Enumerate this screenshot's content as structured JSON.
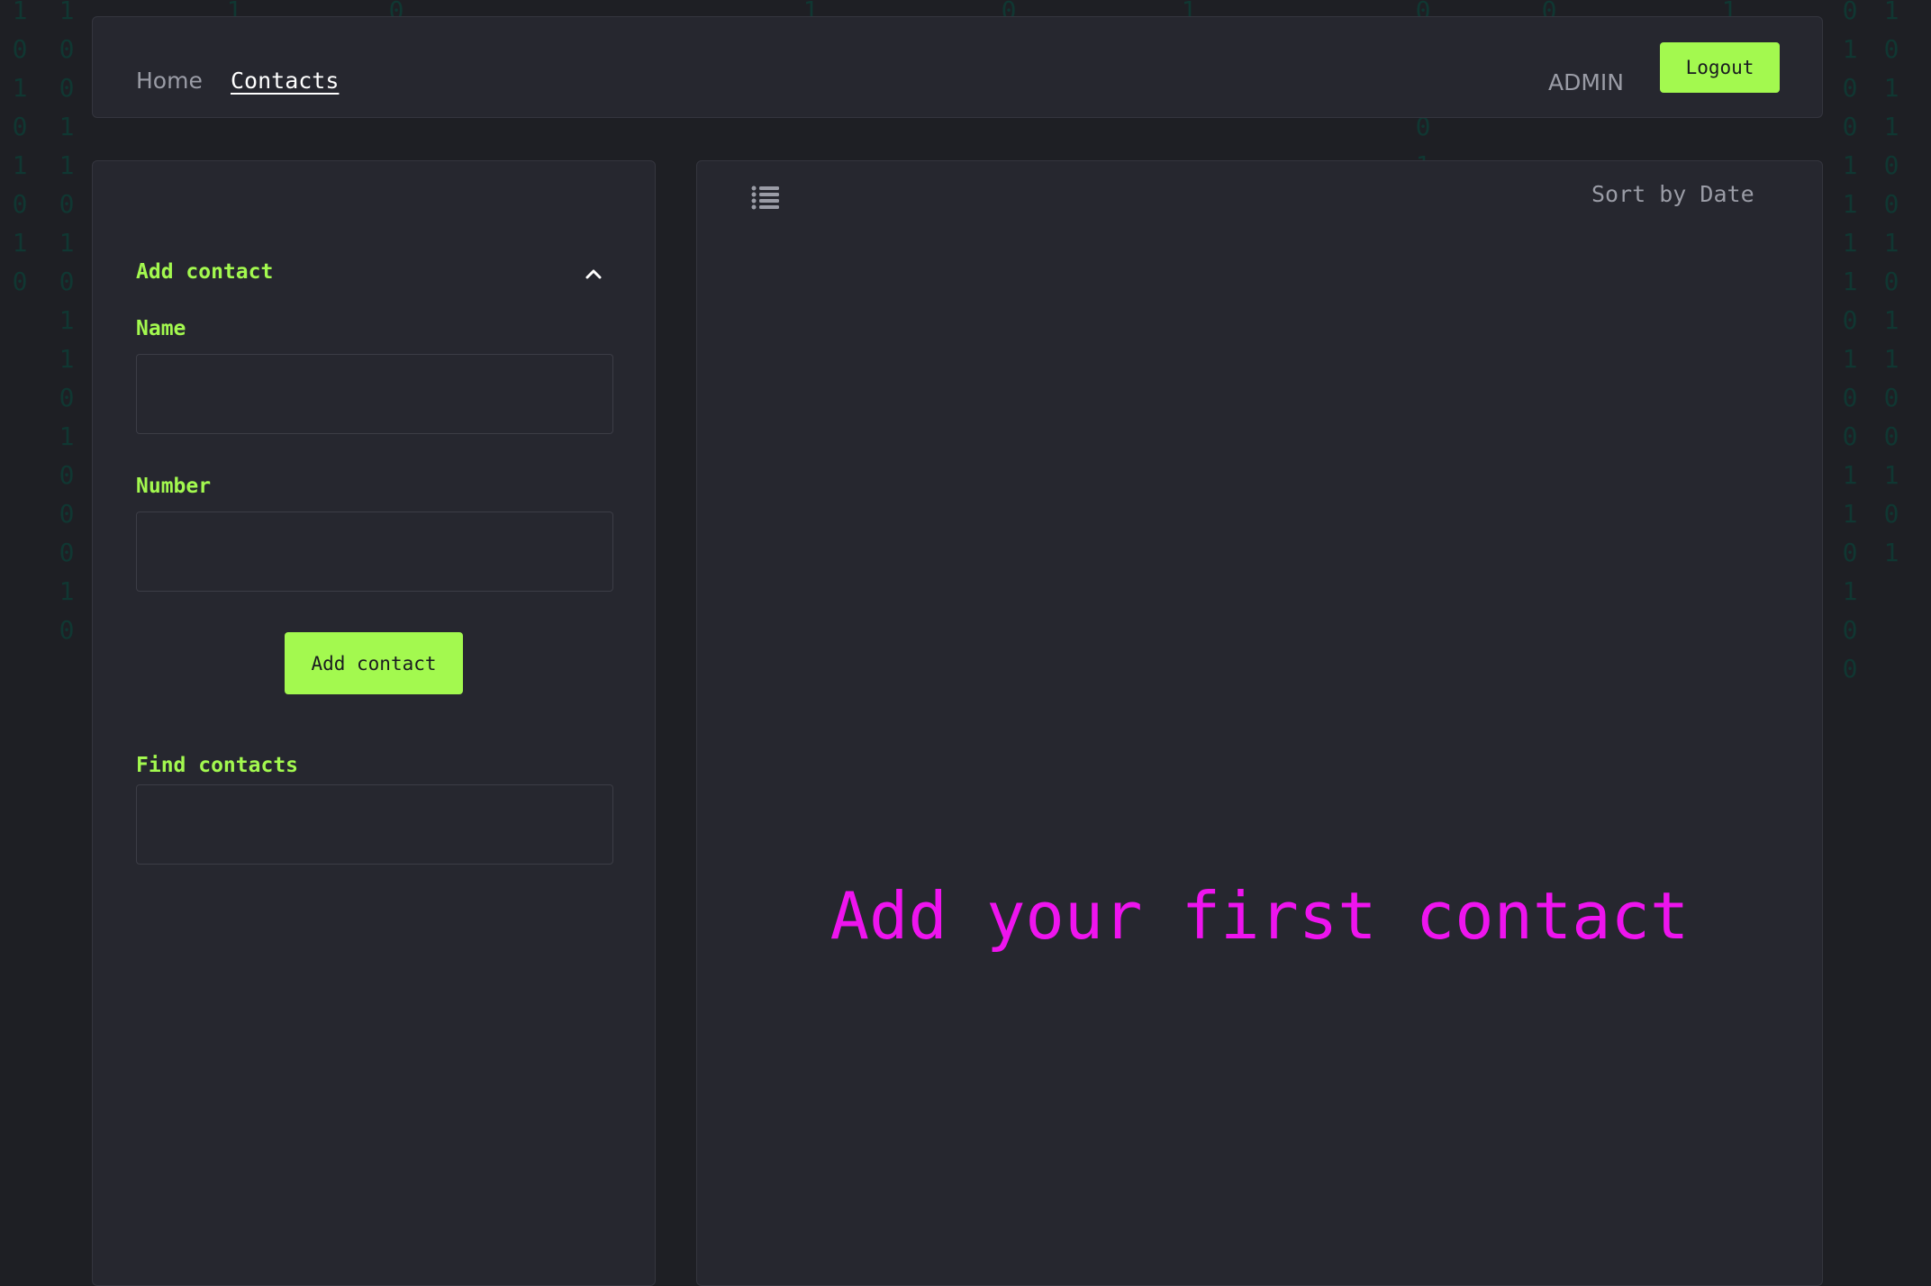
{
  "header": {
    "nav": [
      {
        "label": "Home"
      },
      {
        "label": "Contacts"
      }
    ],
    "user_name": "ADMIN",
    "logout_label": "Logout"
  },
  "sidebar": {
    "add_section_title": "Add contact",
    "name_label": "Name",
    "name_value": "",
    "number_label": "Number",
    "number_value": "",
    "submit_label": "Add contact",
    "find_label": "Find contacts",
    "find_value": ""
  },
  "contacts": {
    "sort_label": "Sort by Date",
    "empty_message": "Add your first contact"
  },
  "colors": {
    "accent": "#a3f94f",
    "empty_message": "#ee14ee",
    "background": "#1e1f24",
    "panel": "#26272f"
  }
}
